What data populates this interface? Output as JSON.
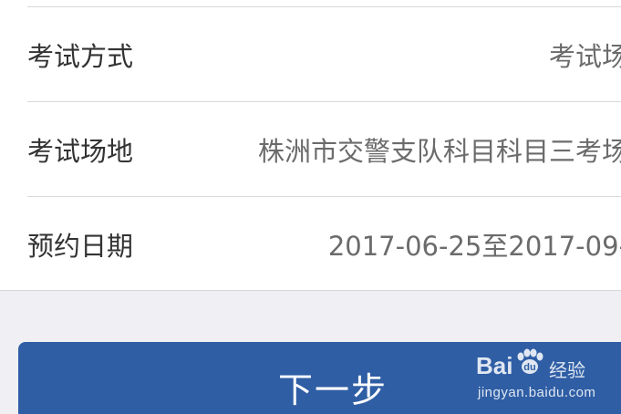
{
  "form": {
    "rows": [
      {
        "label": "考试方式",
        "value": "考试场"
      },
      {
        "label": "考试场地",
        "value": "株洲市交警支队科目科目三考场"
      },
      {
        "label": "预约日期",
        "value": "2017-06-25至2017-09-"
      }
    ]
  },
  "actions": {
    "next_label": "下一步"
  },
  "watermark": {
    "brand_part1": "Bai",
    "brand_part2": "经验",
    "url": "jingyan.baidu.com"
  },
  "colors": {
    "background": "#efeff4",
    "primary_button": "#2f5ea5",
    "label_text": "#333333",
    "value_text": "#6b6b6b"
  }
}
